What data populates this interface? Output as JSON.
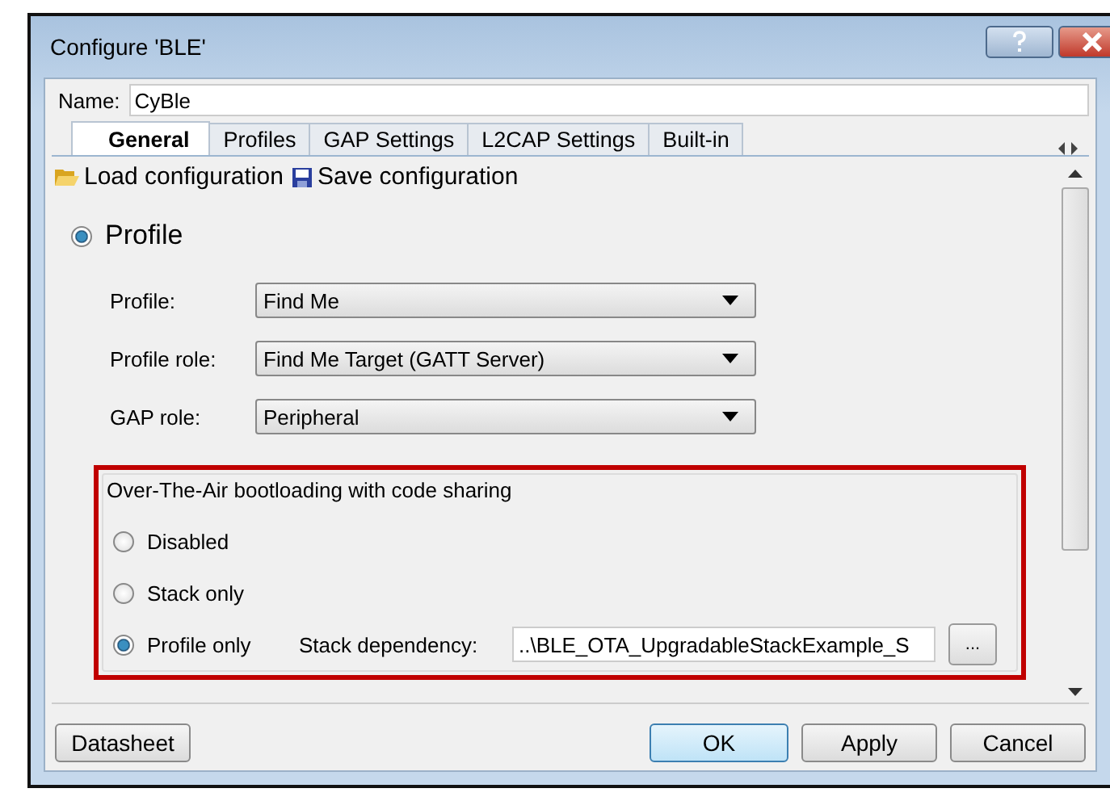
{
  "window": {
    "title": "Configure 'BLE'"
  },
  "name_field": {
    "label": "Name:",
    "value": "CyBle"
  },
  "tabs": [
    {
      "label": "General",
      "selected": true
    },
    {
      "label": "Profiles",
      "selected": false
    },
    {
      "label": "GAP Settings",
      "selected": false
    },
    {
      "label": "L2CAP Settings",
      "selected": false
    },
    {
      "label": "Built-in",
      "selected": false
    }
  ],
  "toolbar": [
    {
      "kind": "load",
      "label": "Load configuration"
    },
    {
      "kind": "save",
      "label": "Save configuration"
    }
  ],
  "profile_option": {
    "label": "Profile",
    "selected": true
  },
  "dropdowns": [
    {
      "label": "Profile:",
      "value": "Find Me"
    },
    {
      "label": "Profile role:",
      "value": "Find Me Target (GATT Server)"
    },
    {
      "label": "GAP role:",
      "value": "Peripheral"
    }
  ],
  "ota_group": {
    "title": "Over-The-Air bootloading with code sharing",
    "highlighted": true,
    "options": [
      {
        "label": "Disabled",
        "selected": false
      },
      {
        "label": "Stack only",
        "selected": false
      },
      {
        "label": "Profile only",
        "selected": true
      }
    ],
    "stack_dependency": {
      "label": "Stack dependency:",
      "value": "..\\BLE_OTA_UpgradableStackExample_S",
      "browse": "..."
    }
  },
  "buttons": [
    {
      "label": "Datasheet",
      "default": false
    },
    {
      "label": "OK",
      "default": true
    },
    {
      "label": "Apply",
      "default": false
    },
    {
      "label": "Cancel",
      "default": false
    }
  ]
}
